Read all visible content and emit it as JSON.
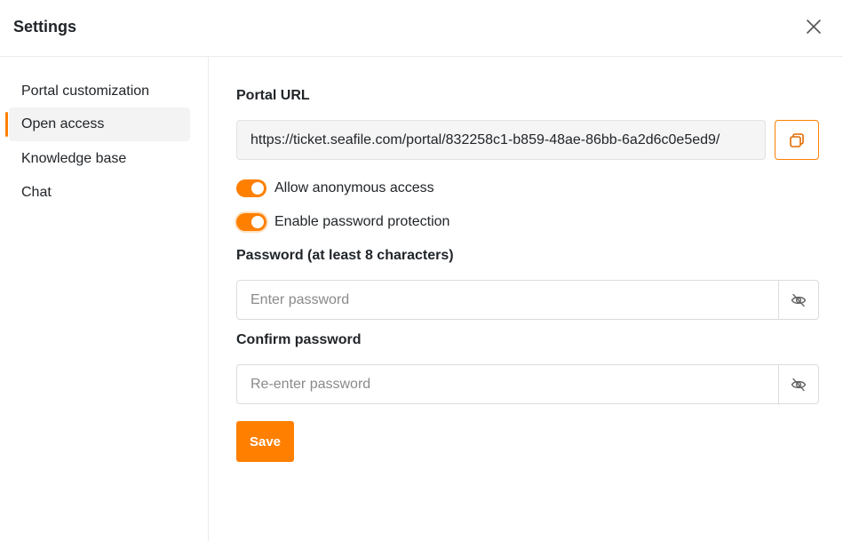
{
  "dialog": {
    "title": "Settings",
    "close_icon": "close-icon"
  },
  "sidebar": {
    "items": [
      {
        "label": "Portal customization",
        "active": false
      },
      {
        "label": "Open access",
        "active": true
      },
      {
        "label": "Knowledge base",
        "active": false
      },
      {
        "label": "Chat",
        "active": false
      }
    ]
  },
  "main": {
    "portal_url_label": "Portal URL",
    "portal_url_value": "https://ticket.seafile.com/portal/832258c1-b859-48ae-86bb-6a2d6c0e5ed9/",
    "copy_icon": "copy-icon",
    "toggles": [
      {
        "label": "Allow anonymous access",
        "checked": true
      },
      {
        "label": "Enable password protection",
        "checked": true
      }
    ],
    "password_label": "Password (at least 8 characters)",
    "password_placeholder": "Enter password",
    "confirm_label": "Confirm password",
    "confirm_placeholder": "Re-enter password",
    "eye_icon": "eye-off-icon",
    "save_label": "Save"
  },
  "colors": {
    "accent": "#ff8000",
    "active_nav_bg": "#f3f3f3",
    "border": "#e9ecef"
  }
}
